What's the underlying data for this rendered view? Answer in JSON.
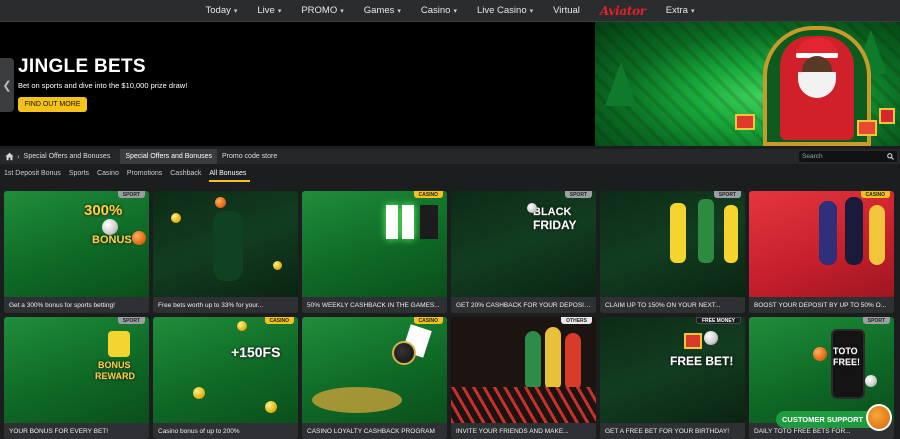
{
  "nav": {
    "items": [
      {
        "label": "Today",
        "chevron": true
      },
      {
        "label": "Live",
        "chevron": true
      },
      {
        "label": "PROMO",
        "chevron": true
      },
      {
        "label": "Games",
        "chevron": true
      },
      {
        "label": "Casino",
        "chevron": true
      },
      {
        "label": "Live Casino",
        "chevron": true
      },
      {
        "label": "Virtual",
        "chevron": false
      }
    ],
    "aviator": "Aviator",
    "extra": "Extra"
  },
  "hero": {
    "title": "JINGLE BETS",
    "subtitle": "Bet on sports and dive into the $10,000 prize draw!",
    "button": "FIND OUT MORE"
  },
  "breadcrumb": {
    "current": "Special Offers and Bonuses",
    "tabs": [
      "Special Offers and Bonuses",
      "Promo code store"
    ],
    "search_placeholder": "Search"
  },
  "filters": [
    "1st Deposit Bonus",
    "Sports",
    "Casino",
    "Promotions",
    "Cashback",
    "All Bonuses"
  ],
  "active_filter": "All Bonuses",
  "cards": [
    {
      "tag": "SPORT",
      "caption": "Get a 300% bonus for sports betting!",
      "art_text": "300% BONUS"
    },
    {
      "tag": "",
      "caption": "Free bets worth up to 33% for your...",
      "art_text": ""
    },
    {
      "tag": "CASINO",
      "caption": "50% WEEKLY CASHBACK IN THE GAMES...",
      "art_text": ""
    },
    {
      "tag": "SPORT",
      "caption": "GET 20% CASHBACK FOR YOUR DEPOSIT...",
      "art_text": "BLACK FRIDAY"
    },
    {
      "tag": "SPORT",
      "caption": "CLAIM UP TO 150% ON YOUR NEXT...",
      "art_text": ""
    },
    {
      "tag": "CASINO",
      "caption": "BOOST YOUR DEPOSIT BY UP TO 50% O...",
      "art_text": ""
    },
    {
      "tag": "SPORT",
      "caption": "YOUR BONUS FOR EVERY BET!",
      "art_text": "BONUS REWARD"
    },
    {
      "tag": "CASINO",
      "caption": "Casino bonus of up to 200%",
      "art_text": "+150FS"
    },
    {
      "tag": "CASINO",
      "caption": "CASINO LOYALTY CASHBACK PROGRAM",
      "art_text": ""
    },
    {
      "tag": "OTHERS",
      "caption": "INVITE YOUR FRIENDS AND MAKE...",
      "art_text": ""
    },
    {
      "tag": "FREE MONEY",
      "caption": "GET A FREE BET FOR YOUR BIRTHDAY!",
      "art_text": "FREE BET!"
    },
    {
      "tag": "SPORT",
      "caption": "DAILY TOTO FREE BETS FOR...",
      "art_text": "TOTO FREE!"
    }
  ],
  "support": {
    "label": "CUSTOMER SUPPORT"
  },
  "colors": {
    "accent": "#f4c21b",
    "brand_green": "#1f8e3b",
    "aviator_red": "#e3222c"
  }
}
